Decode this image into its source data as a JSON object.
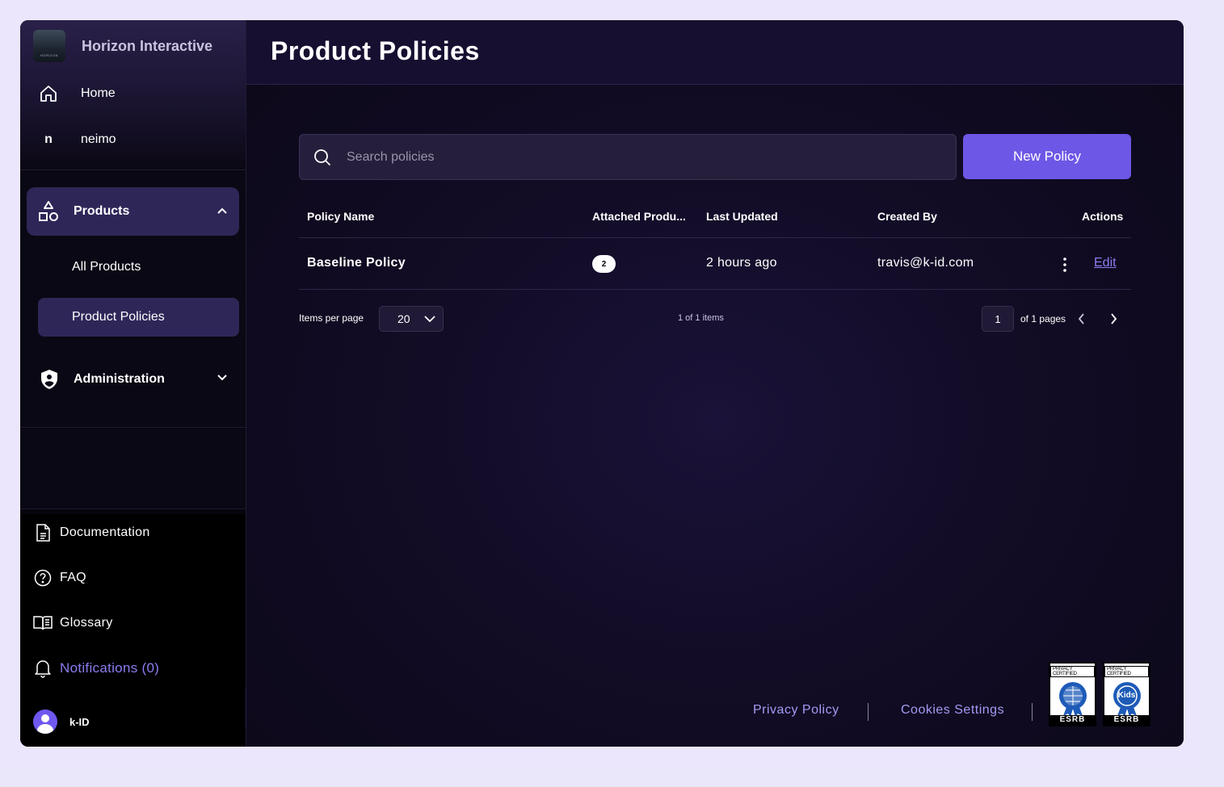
{
  "org": {
    "name": "Horizon Interactive",
    "logo_text": "HORIZON"
  },
  "nav": {
    "home": "Home",
    "neimo_initial": "n",
    "neimo": "neimo"
  },
  "products": {
    "label": "Products",
    "all": "All Products",
    "policies": "Product Policies"
  },
  "administration": {
    "label": "Administration"
  },
  "footer_nav": {
    "documentation": "Documentation",
    "faq": "FAQ",
    "glossary": "Glossary",
    "notifications": "Notifications (0)"
  },
  "user": {
    "name": "k-ID"
  },
  "page": {
    "title": "Product Policies"
  },
  "search": {
    "placeholder": "Search policies",
    "value": ""
  },
  "new_policy_label": "New Policy",
  "table": {
    "headers": [
      "Policy Name",
      "Attached Produ...",
      "Last Updated",
      "Created By",
      "Actions"
    ],
    "rows": [
      {
        "name": "Baseline Policy",
        "attached": "2",
        "updated": "2 hours ago",
        "created_by": "travis@k-id.com",
        "edit": "Edit"
      }
    ]
  },
  "pagination": {
    "items_per_page_label": "Items per page",
    "items_per_page": "20",
    "count": "1 of 1 items",
    "page": "1",
    "of_pages": "of 1 pages"
  },
  "footer": {
    "privacy": "Privacy Policy",
    "cookies": "Cookies Settings"
  },
  "seals": [
    {
      "top": "PRIVACY CERTIFIED",
      "bottom": "ESRB",
      "center": ""
    },
    {
      "top": "PRIVACY CERTIFIED",
      "bottom": "ESRB",
      "center": "Kids"
    }
  ],
  "colors": {
    "accent": "#6d57e6",
    "link": "#8b7cf0",
    "sidebar_active": "#2f2658"
  }
}
